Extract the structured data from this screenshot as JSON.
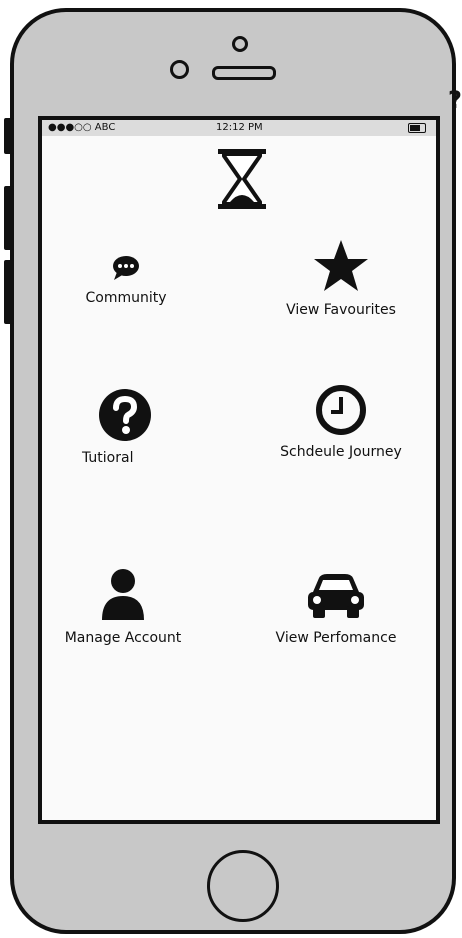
{
  "status_bar": {
    "carrier": "●●●○○ ABC",
    "time": "12:12 PM"
  },
  "menu": {
    "community": "Community",
    "favourites": "View Favourites",
    "tutorial": "Tutioral",
    "schedule": "Schdeule Journey",
    "account": "Manage Account",
    "performance": "View Perfomance"
  },
  "icons": {
    "logo": "hourglass-icon",
    "community": "chat-bubble-icon",
    "favourites": "star-icon",
    "tutorial": "question-icon",
    "schedule": "clock-icon",
    "account": "user-icon",
    "performance": "car-icon"
  }
}
